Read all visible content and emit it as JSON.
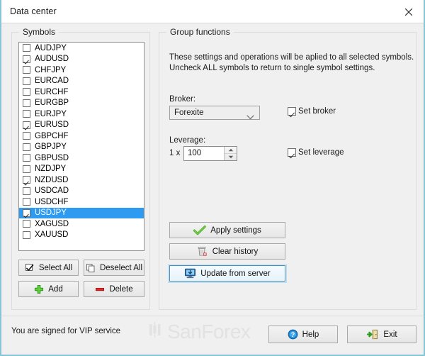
{
  "window": {
    "title": "Data center",
    "close_icon": "close-icon"
  },
  "symbols_panel": {
    "legend": "Symbols",
    "items": [
      {
        "label": "AUDJPY",
        "checked": false,
        "selected": false
      },
      {
        "label": "AUDUSD",
        "checked": true,
        "selected": false
      },
      {
        "label": "CHFJPY",
        "checked": false,
        "selected": false
      },
      {
        "label": "EURCAD",
        "checked": false,
        "selected": false
      },
      {
        "label": "EURCHF",
        "checked": false,
        "selected": false
      },
      {
        "label": "EURGBP",
        "checked": false,
        "selected": false
      },
      {
        "label": "EURJPY",
        "checked": false,
        "selected": false
      },
      {
        "label": "EURUSD",
        "checked": true,
        "selected": false
      },
      {
        "label": "GBPCHF",
        "checked": false,
        "selected": false
      },
      {
        "label": "GBPJPY",
        "checked": false,
        "selected": false
      },
      {
        "label": "GBPUSD",
        "checked": false,
        "selected": false
      },
      {
        "label": "NZDJPY",
        "checked": false,
        "selected": false
      },
      {
        "label": "NZDUSD",
        "checked": true,
        "selected": false
      },
      {
        "label": "USDCAD",
        "checked": false,
        "selected": false
      },
      {
        "label": "USDCHF",
        "checked": false,
        "selected": false
      },
      {
        "label": "USDJPY",
        "checked": true,
        "selected": true
      },
      {
        "label": "XAGUSD",
        "checked": false,
        "selected": false
      },
      {
        "label": "XAUUSD",
        "checked": false,
        "selected": false
      }
    ],
    "buttons": {
      "select_all": "Select All",
      "deselect_all": "Deselect All",
      "add": "Add",
      "delete": "Delete"
    },
    "icons": {
      "select_all": "checkbox-checked-icon",
      "deselect_all": "copy-pages-icon",
      "add": "green-plus-icon",
      "delete": "red-minus-icon"
    }
  },
  "group_functions": {
    "legend": "Group functions",
    "description_line1": "These settings and operations will be aplied to all selected symbols.",
    "description_line2": "Uncheck ALL symbols to return to single symbol settings.",
    "broker": {
      "label": "Broker:",
      "value": "Forexite",
      "dropdown_icon": "chevron-down-icon",
      "set_checkbox_label": "Set broker",
      "set_checkbox_checked": true
    },
    "leverage": {
      "label": "Leverage:",
      "prefix": "1 x",
      "value": "100",
      "spinner_up_icon": "caret-up-icon",
      "spinner_down_icon": "caret-down-icon",
      "set_checkbox_label": "Set leverage",
      "set_checkbox_checked": true
    },
    "actions": {
      "apply_settings": "Apply settings",
      "clear_history": "Clear history",
      "update_from_server": "Update from server",
      "apply_icon": "green-check-icon",
      "clear_icon": "trash-bin-icon",
      "update_icon": "monitor-download-icon",
      "focused_action": "update_from_server"
    }
  },
  "statusbar": {
    "message": "You are signed for VIP service",
    "watermark_text": "SanForex",
    "watermark_icon": "candlestick-bars-icon",
    "help_label": "Help",
    "help_icon": "question-circle-icon",
    "exit_label": "Exit",
    "exit_icon": "exit-door-icon"
  },
  "colors": {
    "window_border": "#87c4d6",
    "dialog_bg": "#f0f0f0",
    "selection_blue": "#2e9bf0",
    "focus_blue": "#3c8fc9",
    "accent_green": "#4caf27",
    "accent_red": "#d42020",
    "help_blue": "#1a85d6",
    "watermark_gray": "#e2e2e2"
  }
}
